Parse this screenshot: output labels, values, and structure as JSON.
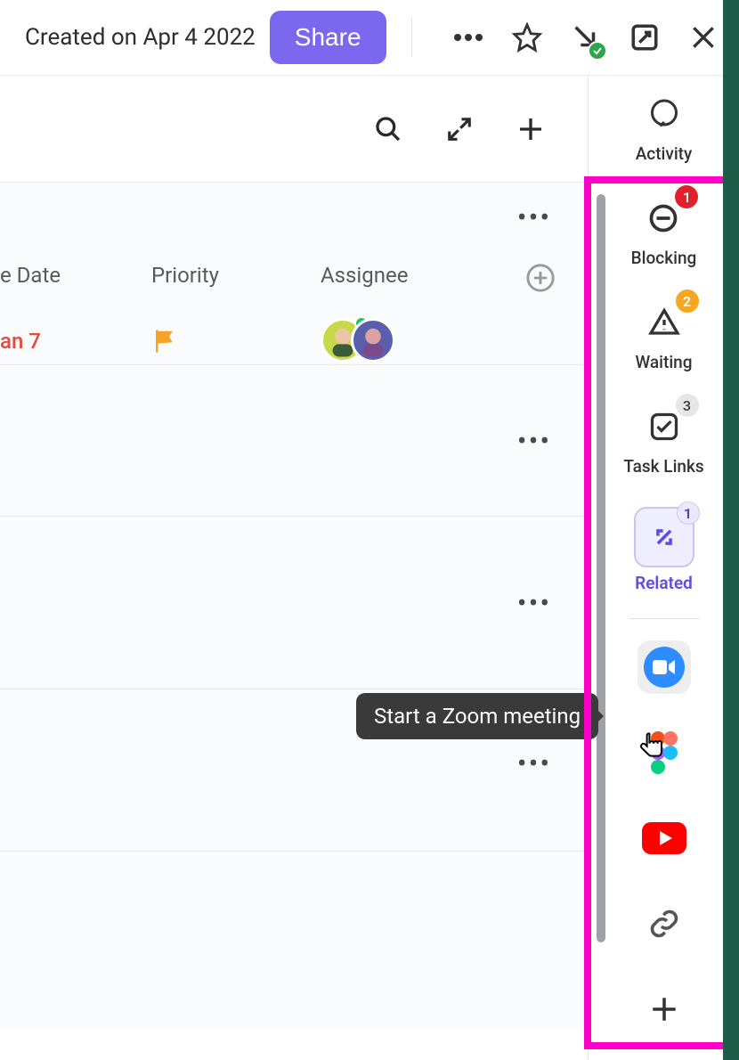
{
  "header": {
    "created_label": "Created on Apr 4 2022",
    "share_label": "Share"
  },
  "columns": {
    "date": "e Date",
    "priority": "Priority",
    "assignee": "Assignee"
  },
  "row": {
    "due_date": "an 7"
  },
  "rail": {
    "activity": "Activity",
    "blocking": "Blocking",
    "blocking_count": "1",
    "waiting": "Waiting",
    "waiting_count": "2",
    "tasklinks": "Task Links",
    "tasklinks_count": "3",
    "related": "Related",
    "related_count": "1"
  },
  "tooltip": {
    "zoom": "Start a Zoom meeting"
  }
}
